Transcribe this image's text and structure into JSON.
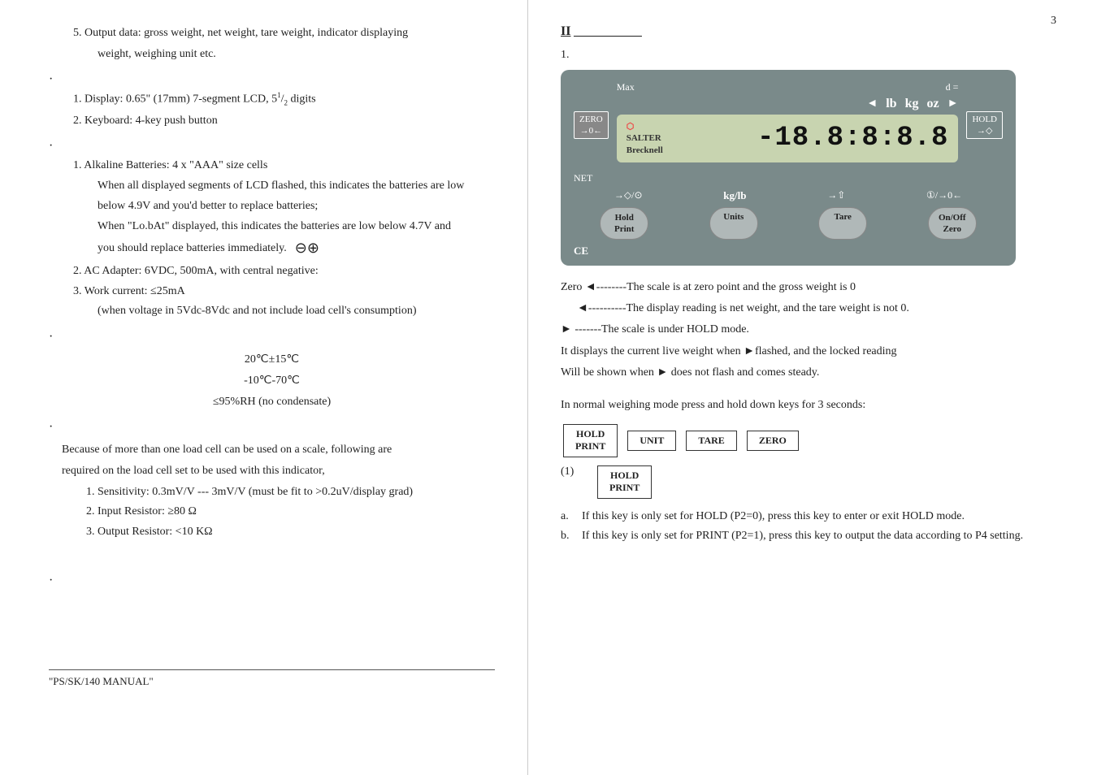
{
  "page": {
    "number": "3",
    "left": {
      "item5": "5. Output data:  gross weight, net weight, tare weight, indicator displaying",
      "item5cont": "weight, weighing unit etc.",
      "bullet1": "·",
      "section_display": "1. Display: 0.65\" (17mm) 7-segment LCD, 5",
      "section_display_sup1": "1",
      "section_display_sup2": "2",
      "section_display_suffix": " digits",
      "section_keyboard": "2. Keyboard: 4-key push button",
      "bullet2": "·",
      "battery_title": "1. Alkaline Batteries: 4 x \"AAA\" size cells",
      "battery_note1": "When all displayed segments of LCD flashed, this indicates the batteries are low",
      "battery_note2": "below 4.9V and you'd better to replace batteries;",
      "battery_note3": "When \"Lo.bAt\" displayed, this indicates the batteries are low below 4.7V and",
      "battery_note4": "you should replace batteries immediately.",
      "ac_adapter": "2. AC Adapter: 6VDC, 500mA, with central negative:",
      "work_current": "3. Work current: ≤25mA",
      "work_current_note": "(when voltage in 5Vdc-8Vdc and not include load cell's consumption)",
      "bullet3": "·",
      "temp_op": "20℃±15℃",
      "temp_storage": "-10℃-70℃",
      "humidity": "≤95%RH (no condensate)",
      "bullet4": "·",
      "load_cell_note": "Because of more than one load cell can be used on a scale, following are",
      "load_cell_note2": "required on the load cell set to be used with this indicator,",
      "sensitivity": "1. Sensitivity: 0.3mV/V --- 3mV/V (must be fit to >0.2uV/display grad)",
      "input_resistor": "2. Input Resistor: ≥80 Ω",
      "output_resistor": "3. Output Resistor: <10 KΩ",
      "bullet5": "·",
      "manual_label": "\"PS/SK/140 MANUAL\""
    },
    "right": {
      "section_label": "II",
      "section_underline": "________________",
      "item_num": "1.",
      "scale": {
        "max_label": "Max",
        "d_label": "d =",
        "zero_btn": "ZERO\n→0←",
        "lb_label": "lb",
        "kg_label": "kg",
        "oz_label": "oz",
        "hold_label": "HOLD\n→◇",
        "net_label": "NET",
        "logo_line1": "SALTER",
        "logo_line2": "Brecknell",
        "display_digits": "-18.8:8:8.8",
        "kgib_label": "kg/lb",
        "arrow_zero": "→◇/⊙",
        "arrow_up": "→⇧",
        "on_off": "①/→0←",
        "btn_hold_print_line1": "Hold",
        "btn_hold_print_line2": "Print",
        "btn_units": "Units",
        "btn_tare": "Tare",
        "btn_onoff_line1": "On/Off",
        "btn_onoff_line2": "Zero",
        "ce": "CE"
      },
      "legend": {
        "zero_line": "Zero ◄--------The scale is at zero point and the gross weight is 0",
        "net_line": "          ◄----------The display reading is net weight, and the tare weight is not 0.",
        "hold_line": "►          -------The scale is under HOLD mode.",
        "flash_note": "It displays the current live weight when ►flashed, and the locked reading",
        "flash_note2": "Will be shown when ► does not flash and comes steady."
      },
      "section2_intro": "In normal weighing mode press and hold down keys for 3 seconds:",
      "keys_row": [
        "HOLD\nPRINT",
        "UNIT",
        "TARE",
        "ZERO"
      ],
      "item1_label": "(1)",
      "item1_key": "HOLD\nPRINT",
      "note_a_label": "a.",
      "note_a": "If this key is only set for HOLD (P2=0), press this key to enter or exit HOLD mode.",
      "note_b_label": "b.",
      "note_b": "If this key is only set for PRINT (P2=1), press this key to output the data according to P4 setting."
    }
  }
}
